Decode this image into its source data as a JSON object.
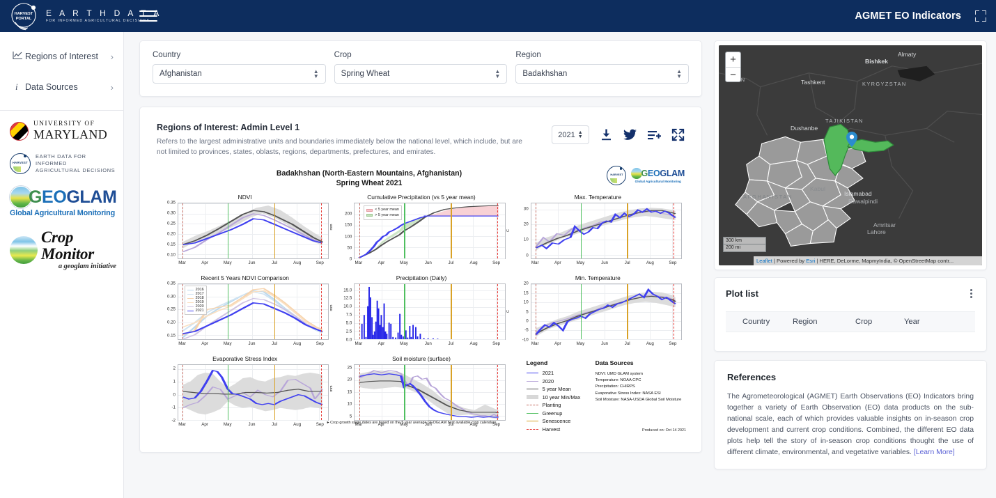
{
  "header": {
    "brand_line1": "E A R T H   D A T A",
    "brand_line2": "FOR INFORMED AGRICULTURAL DECISIONS",
    "brand_logo_text": "HARVEST PORTAL",
    "title": "AGMET EO Indicators",
    "menu_icon": "hamburger-icon",
    "expand_icon": "expand-icon"
  },
  "sidebar": {
    "items": [
      {
        "label": "Regions of Interest",
        "icon": "chart-line-icon",
        "chevron": "›"
      },
      {
        "label": "Data Sources",
        "icon": "info-icon",
        "chevron": "›"
      }
    ],
    "logos": [
      {
        "name": "university-of-maryland",
        "line1": "UNIVERSITY OF",
        "line2": "MARYLAND"
      },
      {
        "name": "harvest",
        "word": "HARVEST",
        "line1": "EARTH DATA FOR INFORMED",
        "line2": "AGRICULTURAL DECISIONS"
      },
      {
        "name": "geoglam",
        "word": "GEOGLAM",
        "sub": "Global Agricultural Monitoring"
      },
      {
        "name": "crop-monitor",
        "line1": "Crop Monitor",
        "line2": "a geoglam initiative"
      }
    ]
  },
  "filters": [
    {
      "label": "Country",
      "value": "Afghanistan"
    },
    {
      "label": "Crop",
      "value": "Spring Wheat"
    },
    {
      "label": "Region",
      "value": "Badakhshan"
    }
  ],
  "plot_panel": {
    "title": "Regions of Interest: Admin Level 1",
    "description": "Refers to the largest administrative units and boundaries immediately below the national level, which include, but are not limited to provinces, states, oblasts, regions, departments, prefectures, and emirates.",
    "year": "2021",
    "tools": [
      {
        "name": "download-icon",
        "label": "Download"
      },
      {
        "name": "twitter-icon",
        "label": "Share on Twitter"
      },
      {
        "name": "add-to-list-icon",
        "label": "Add to plot list"
      },
      {
        "name": "fullscreen-icon",
        "label": "Fullscreen"
      }
    ]
  },
  "figure": {
    "title_line1": "Badakhshan (North-Eastern Mountains, Afghanistan)",
    "title_line2": "Spring Wheat 2021",
    "logos": [
      {
        "name": "harvest-logo",
        "word": "HARVEST"
      },
      {
        "name": "geoglam-logo",
        "word": "GEOGLAM",
        "sub": "Global Agricultural Monitoring"
      }
    ],
    "footnote": "Crop growth stage dates are based on the 5 year average GEOGLAM best available crop calendars",
    "produced": "Produced on: Oct 14 2021",
    "legend": {
      "title": "Legend",
      "items": [
        {
          "label": "2021",
          "style": "line",
          "color": "#4040f0"
        },
        {
          "label": "2020",
          "style": "line",
          "color": "#b8a6d9"
        },
        {
          "label": "5 year Mean",
          "style": "line",
          "color": "#545454"
        },
        {
          "label": "10 year Min/Max",
          "style": "band",
          "color": "#d8d8d8"
        },
        {
          "label": "Planting",
          "style": "dash",
          "color": "#c46a60"
        },
        {
          "label": "Greenup",
          "style": "line",
          "color": "#4fbf5f"
        },
        {
          "label": "Senescence",
          "style": "line",
          "color": "#d9a227"
        },
        {
          "label": "Harvest",
          "style": "dash",
          "color": "#e53935"
        }
      ]
    },
    "data_sources": {
      "title": "Data Sources",
      "items": [
        "NDVI: UMD GLAM system",
        "Temperature: NOAA CPC",
        "Precipitation: CHIRPS",
        "Evaporative Stress Index: NASA ESI",
        "Soil Moisture: NASA-USDA Global Soil Moisture"
      ]
    }
  },
  "chart_data": [
    {
      "type": "line",
      "title": "NDVI",
      "xlabel": "",
      "ylabel": "NDVI",
      "x": [
        "Mar",
        "Apr",
        "May",
        "Jun",
        "Jul",
        "Aug",
        "Sep"
      ],
      "ylim": [
        0.1,
        0.37
      ],
      "yticks": [
        0.1,
        0.15,
        0.2,
        0.25,
        0.3,
        0.35
      ],
      "grid": true,
      "series": [
        {
          "name": "2021",
          "color": "#4040f0",
          "values": [
            0.172,
            0.196,
            0.232,
            0.296,
            0.263,
            0.222,
            0.19
          ]
        },
        {
          "name": "2020",
          "color": "#b8a6d9",
          "values": [
            0.138,
            0.19,
            0.248,
            0.312,
            0.281,
            0.23,
            0.188
          ]
        },
        {
          "name": "5 year Mean",
          "color": "#545454",
          "values": [
            0.172,
            0.205,
            0.263,
            0.332,
            0.292,
            0.236,
            0.188
          ]
        }
      ],
      "band": {
        "name": "10 year Min/Max",
        "color": "#d8d8d8",
        "lower": [
          0.148,
          0.176,
          0.232,
          0.3,
          0.262,
          0.212,
          0.176
        ],
        "upper": [
          0.196,
          0.236,
          0.3,
          0.362,
          0.326,
          0.262,
          0.202
        ]
      },
      "markers": [
        {
          "name": "Planting",
          "x": "Mar",
          "color": "#c46a60",
          "style": "dashed"
        },
        {
          "name": "Greenup",
          "x": "May",
          "color": "#4fbf5f",
          "style": "solid"
        },
        {
          "name": "Senescence",
          "x": "Jul",
          "color": "#d9a227",
          "style": "solid"
        },
        {
          "name": "Harvest",
          "x": "Sep",
          "color": "#e53935",
          "style": "dashed"
        }
      ]
    },
    {
      "type": "area",
      "title": "Cumulative Precipitation (vs 5 year mean)",
      "ylabel": "mm",
      "x": [
        "Mar",
        "Apr",
        "May",
        "Jun",
        "Jul",
        "Aug",
        "Sep"
      ],
      "ylim": [
        0,
        250
      ],
      "yticks": [
        0,
        50,
        100,
        150,
        200
      ],
      "legend_position": "upper-left",
      "legend_entries": [
        {
          "label": "< 5 year mean",
          "color": "#f2b8bd"
        },
        {
          "label": "> 5 year mean",
          "color": "#b9dbb2"
        }
      ],
      "series": [
        {
          "name": "2021",
          "color": "#4040f0",
          "values": [
            3,
            130,
            163,
            192,
            192,
            192,
            192
          ]
        },
        {
          "name": "5 year Mean",
          "color": "#545454",
          "values": [
            3,
            100,
            152,
            208,
            226,
            233,
            237
          ]
        }
      ]
    },
    {
      "type": "line",
      "title": "Max. Temperature",
      "ylabel": "C",
      "x": [
        "Mar",
        "Apr",
        "May",
        "Jun",
        "Jul",
        "Aug",
        "Sep"
      ],
      "ylim": [
        -2,
        34
      ],
      "yticks": [
        0,
        10,
        20,
        30
      ],
      "series": [
        {
          "name": "2021",
          "color": "#4040f0",
          "values": [
            6.2,
            11.5,
            20.5,
            24.0,
            29.5,
            30.5,
            26.5
          ]
        },
        {
          "name": "2020",
          "color": "#b8a6d9",
          "values": [
            6.0,
            14.0,
            19.5,
            24.5,
            28.0,
            29.5,
            26.0
          ]
        },
        {
          "name": "5 year Mean",
          "color": "#545454",
          "values": [
            6.0,
            13.0,
            19.5,
            24.0,
            28.0,
            29.5,
            27.0
          ]
        }
      ],
      "markers": [
        {
          "name": "Planting",
          "x": "Mar",
          "color": "#c46a60",
          "style": "dashed"
        },
        {
          "name": "Greenup",
          "x": "May",
          "color": "#4fbf5f",
          "style": "solid"
        },
        {
          "name": "Senescence",
          "x": "Jul",
          "color": "#d9a227",
          "style": "solid"
        },
        {
          "name": "Harvest",
          "x": "Sep",
          "color": "#e53935",
          "style": "dashed"
        }
      ]
    },
    {
      "type": "line",
      "title": "Recent 5 Years NDVI Comparison",
      "x": [
        "Mar",
        "Apr",
        "May",
        "Jun",
        "Jul",
        "Aug",
        "Sep"
      ],
      "ylim": [
        0.13,
        0.37
      ],
      "yticks": [
        0.15,
        0.2,
        0.25,
        0.3,
        0.35
      ],
      "legend_position": "upper-left",
      "series": [
        {
          "name": "2016",
          "color": "#bcd9ee",
          "values": [
            0.14,
            0.215,
            0.3,
            0.34,
            0.27,
            0.215,
            0.172
          ]
        },
        {
          "name": "2017",
          "color": "#cfe3f2",
          "values": [
            0.162,
            0.24,
            0.31,
            0.335,
            0.268,
            0.212,
            0.175
          ]
        },
        {
          "name": "2018",
          "color": "#f6d3ad",
          "values": [
            0.152,
            0.254,
            0.3,
            0.348,
            0.29,
            0.228,
            0.186
          ]
        },
        {
          "name": "2019",
          "color": "#fadfc0",
          "values": [
            0.17,
            0.228,
            0.29,
            0.342,
            0.285,
            0.226,
            0.184
          ]
        },
        {
          "name": "2020",
          "color": "#cfc3e2",
          "values": [
            0.138,
            0.19,
            0.248,
            0.312,
            0.281,
            0.23,
            0.188
          ]
        },
        {
          "name": "2021",
          "color": "#4040f0",
          "values": [
            0.172,
            0.196,
            0.232,
            0.296,
            0.263,
            0.222,
            0.19
          ]
        }
      ]
    },
    {
      "type": "bar",
      "title": "Precipitation (Daily)",
      "ylabel": "mm",
      "x": [
        "Mar",
        "Apr",
        "May",
        "Jun",
        "Jul",
        "Aug",
        "Sep"
      ],
      "ylim": [
        0,
        17
      ],
      "yticks": [
        0.0,
        2.5,
        5.0,
        7.5,
        10.0,
        12.5,
        15.0
      ],
      "bar_color": "#2626e8",
      "peak_value": 16.0,
      "peak_month": "Mar"
    },
    {
      "type": "line",
      "title": "Min. Temperature",
      "ylabel": "C",
      "x": [
        "Mar",
        "Apr",
        "May",
        "Jun",
        "Jul",
        "Aug",
        "Sep"
      ],
      "ylim": [
        -10,
        20
      ],
      "yticks": [
        -10,
        -5,
        0,
        5,
        10,
        15,
        20
      ],
      "series": [
        {
          "name": "2021",
          "color": "#4040f0",
          "values": [
            -6.0,
            0.5,
            6.0,
            10.5,
            15.0,
            17.0,
            11.5
          ]
        },
        {
          "name": "2020",
          "color": "#b8a6d9",
          "values": [
            -4.0,
            3.0,
            6.5,
            10.0,
            13.5,
            15.0,
            11.0
          ]
        },
        {
          "name": "5 year Mean",
          "color": "#545454",
          "values": [
            -5.0,
            2.0,
            6.0,
            10.0,
            13.0,
            15.0,
            11.0
          ]
        }
      ]
    },
    {
      "type": "line",
      "title": "Evaporative Stress Index",
      "x": [
        "Mar",
        "Apr",
        "May",
        "Jun",
        "Jul",
        "Aug",
        "Sep"
      ],
      "ylim": [
        -2,
        2.4
      ],
      "yticks": [
        -2,
        -1,
        0,
        1,
        2
      ],
      "series": [
        {
          "name": "2021",
          "color": "#4040f0",
          "values": [
            -0.15,
            1.85,
            0.05,
            -0.75,
            -0.8,
            -0.55,
            -0.85
          ]
        },
        {
          "name": "2020",
          "color": "#b8a6d9",
          "values": [
            -1.0,
            0.55,
            -0.4,
            0.1,
            -0.1,
            1.55,
            0.2
          ]
        },
        {
          "name": "5 year Mean",
          "color": "#545454",
          "values": [
            0.25,
            0.12,
            0.02,
            0.12,
            0.15,
            0.35,
            0.25
          ]
        }
      ],
      "band": {
        "name": "10 year Min/Max",
        "color": "#d8d8d8",
        "lower": [
          -0.85,
          -1.2,
          -0.55,
          -0.95,
          -1.0,
          -0.95,
          -1.0
        ],
        "upper": [
          0.9,
          1.8,
          0.6,
          1.15,
          1.05,
          1.35,
          1.3
        ]
      }
    },
    {
      "type": "line",
      "title": "Soil moisture (surface)",
      "ylabel": "mm",
      "x": [
        "Mar",
        "Apr",
        "May",
        "Jun",
        "Jul",
        "Aug",
        "Sep"
      ],
      "ylim": [
        2.5,
        26
      ],
      "yticks": [
        5,
        10,
        15,
        20,
        25
      ],
      "series": [
        {
          "name": "2021",
          "color": "#4040f0",
          "values": [
            23.3,
            24.0,
            18.5,
            8.0,
            4.3,
            3.4,
            3.3
          ]
        },
        {
          "name": "2020",
          "color": "#b8a6d9",
          "values": [
            21.0,
            24.4,
            21.5,
            15.5,
            7.5,
            5.0,
            4.4
          ]
        },
        {
          "name": "5 year Mean",
          "color": "#545454",
          "values": [
            20.8,
            21.0,
            19.4,
            12.5,
            7.6,
            6.2,
            6.0
          ]
        }
      ],
      "band": {
        "name": "10 year Min/Max",
        "color": "#d8d8d8",
        "lower": [
          17.0,
          16.0,
          14.5,
          7.0,
          5.0,
          4.0,
          4.0
        ],
        "upper": [
          24.0,
          24.5,
          23.5,
          20.0,
          10.5,
          11.5,
          9.5
        ]
      }
    }
  ],
  "map": {
    "zoom_in": "+",
    "zoom_out": "−",
    "labels": [
      {
        "text": "Almaty",
        "type": "city"
      },
      {
        "text": "Bishkek",
        "type": "city"
      },
      {
        "text": "Tashkent",
        "type": "city"
      },
      {
        "text": "Dushanbe",
        "type": "city"
      },
      {
        "text": "Islamabad",
        "type": "city"
      },
      {
        "text": "Rawalpindi",
        "type": "city"
      },
      {
        "text": "Amritsar",
        "type": "city"
      },
      {
        "text": "Lahore",
        "type": "city"
      },
      {
        "text": "KYRGYZSTAN",
        "type": "country"
      },
      {
        "text": "TAJIKISTAN",
        "type": "country"
      },
      {
        "text": "TAN",
        "type": "country"
      },
      {
        "text": "AFGHANISTAN",
        "type": "country"
      },
      {
        "text": "Kabul",
        "type": "city-dim"
      }
    ],
    "scale": {
      "km": "300 km",
      "mi": "200 mi"
    },
    "attribution_pre": "Leaflet",
    "attribution_mid": " | Powered by ",
    "attribution_esri": "Esri",
    "attribution_post": " | HERE, DeLorme, MapmyIndia, © OpenStreetMap contr..."
  },
  "plot_list": {
    "title": "Plot list",
    "menu_icon": "kebab-menu-icon",
    "columns": [
      "Country",
      "Region",
      "Crop",
      "Year"
    ],
    "rows": []
  },
  "references": {
    "title": "References",
    "body": "The Agrometeorological (AGMET) Earth Observations (EO) Indicators bring together a variety of Earth Observation (EO) data products on the sub-national scale, each of which provides valuable insights on in-season crop development and current crop conditions. Combined, the different EO data plots help tell the story of in-season crop conditions thought the use of different climate, environmental, and vegetative variables. ",
    "link": "[Learn More]"
  },
  "colors": {
    "brand_navy": "#0d2d5e",
    "accent_blue": "#4040f0",
    "greenup": "#4fbf5f",
    "senescence": "#d9a227",
    "harvest": "#e53935",
    "planting": "#c46a60"
  }
}
